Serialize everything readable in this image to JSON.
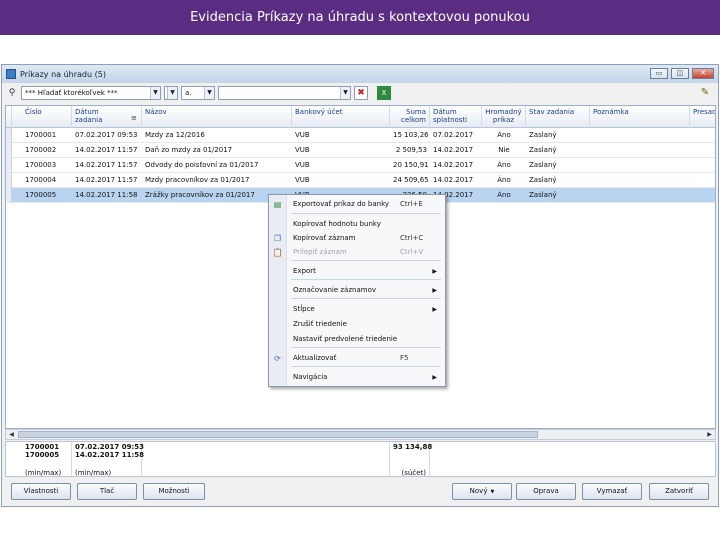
{
  "slide": {
    "title": "Evidencia Príkazy na úhradu s kontextovou ponukou"
  },
  "window": {
    "title": "Príkazy na úhradu (5)",
    "controls": [
      "▭",
      "◫",
      "✕"
    ]
  },
  "toolbar": {
    "find_icon": "binoculars-icon",
    "filter_value": "*** Hľadať ktorékoľvek ***",
    "operator_value": "a.",
    "text_value": "",
    "clear_label": "✖",
    "export_label": "X",
    "right_icon": "tools-icon"
  },
  "columns": [
    {
      "key": "cislo",
      "label": "Číslo"
    },
    {
      "key": "datum_zadania",
      "label": "Dátum\nzadania"
    },
    {
      "key": "nazov",
      "label": "Názov"
    },
    {
      "key": "bankovy_ucet",
      "label": "Bankový účet"
    },
    {
      "key": "suma",
      "label": "Suma\ncelkom"
    },
    {
      "key": "splatnost",
      "label": "Dátum\nsplatnosti"
    },
    {
      "key": "hromadny",
      "label": "Hromadný\npríkaz"
    },
    {
      "key": "stav",
      "label": "Stav zadania"
    },
    {
      "key": "poznamka",
      "label": "Poznámka"
    },
    {
      "key": "presada",
      "label": "Presada"
    }
  ],
  "rows": [
    {
      "cislo": "1700001",
      "datum_zadania": "07.02.2017 09:53",
      "nazov": "Mzdy za 12/2016",
      "bankovy_ucet": "VUB",
      "suma": "15 103,26",
      "splatnost": "07.02.2017",
      "hromadny": "Áno",
      "stav": "Zaslaný",
      "selected": false
    },
    {
      "cislo": "1700002",
      "datum_zadania": "14.02.2017 11:57",
      "nazov": "Daň zo mzdy za 01/2017",
      "bankovy_ucet": "VUB",
      "suma": "2 509,53",
      "splatnost": "14.02.2017",
      "hromadny": "Nie",
      "stav": "Zaslaný",
      "selected": false
    },
    {
      "cislo": "1700003",
      "datum_zadania": "14.02.2017 11:57",
      "nazov": "Odvody do poisťovní za 01/2017",
      "bankovy_ucet": "VUB",
      "suma": "20 150,91",
      "splatnost": "14.02.2017",
      "hromadny": "Áno",
      "stav": "Zaslaný",
      "selected": false
    },
    {
      "cislo": "1700004",
      "datum_zadania": "14.02.2017 11:57",
      "nazov": "Mzdy pracovníkov za 01/2017",
      "bankovy_ucet": "VUB",
      "suma": "24 509,65",
      "splatnost": "14.02.2017",
      "hromadny": "Áno",
      "stav": "Zaslaný",
      "selected": false
    },
    {
      "cislo": "1700005",
      "datum_zadania": "14.02.2017 11:58",
      "nazov": "Zrážky pracovníkov za 01/2017",
      "bankovy_ucet": "VUB",
      "suma": "326,50",
      "splatnost": "14.02.2017",
      "hromadny": "Áno",
      "stav": "Zaslaný",
      "selected": true
    }
  ],
  "summary": {
    "cislo_min": "1700001",
    "cislo_max": "1700005",
    "cislo_label": "(min/max)",
    "datum_min": "07.02.2017 09:53",
    "datum_max": "14.02.2017 11:58",
    "datum_label": "(min/max)",
    "suma_total": "93 134,88",
    "suma_label": "(súčet)"
  },
  "context_menu": {
    "items": [
      {
        "label": "Exportovať príkaz do banky",
        "shortcut": "Ctrl+E",
        "icon": "export-bank-icon",
        "disabled": false,
        "submenu": false
      },
      {
        "label": "Kopírovať hodnotu bunky",
        "shortcut": "",
        "icon": "",
        "disabled": false,
        "submenu": false
      },
      {
        "label": "Kopírovať záznam",
        "shortcut": "Ctrl+C",
        "icon": "copy-icon",
        "disabled": false,
        "submenu": false
      },
      {
        "label": "Prilepiť záznam",
        "shortcut": "Ctrl+V",
        "icon": "paste-icon",
        "disabled": true,
        "submenu": false
      },
      {
        "label": "Export",
        "shortcut": "",
        "icon": "",
        "disabled": false,
        "submenu": true
      },
      {
        "label": "Označovanie záznamov",
        "shortcut": "",
        "icon": "",
        "disabled": false,
        "submenu": true
      },
      {
        "label": "Stĺpce",
        "shortcut": "",
        "icon": "",
        "disabled": false,
        "submenu": true
      },
      {
        "label": "Zrušiť triedenie",
        "shortcut": "",
        "icon": "",
        "disabled": false,
        "submenu": false
      },
      {
        "label": "Nastaviť predvolené triedenie",
        "shortcut": "",
        "icon": "",
        "disabled": false,
        "submenu": false
      },
      {
        "label": "Aktualizovať",
        "shortcut": "F5",
        "icon": "refresh-icon",
        "disabled": false,
        "submenu": false
      },
      {
        "label": "Navigácia",
        "shortcut": "",
        "icon": "",
        "disabled": false,
        "submenu": true
      }
    ]
  },
  "buttons": {
    "vlastnosti": "Vlastnosti",
    "tlac": "Tlač",
    "moznosti": "Možnosti",
    "novy": "Nový",
    "oprava": "Oprava",
    "vymazat": "Vymazať",
    "zatvorit": "Zatvoriť"
  },
  "colors": {
    "header_band": "#5b2d82",
    "selected_row": "#b8d4f0",
    "column_header_text": "#1a3f86"
  }
}
